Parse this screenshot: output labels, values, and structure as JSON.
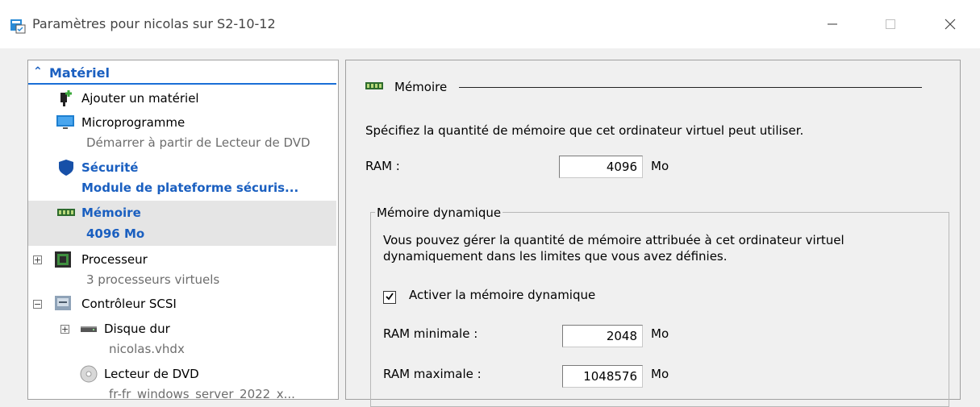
{
  "window": {
    "title": "Paramètres pour nicolas sur S2-10-12",
    "minimize_glyph": "—",
    "maximize_glyph": "☐",
    "close_glyph": "✕"
  },
  "sidebar": {
    "section_label": "Matériel",
    "items": [
      {
        "label": "Ajouter un matériel",
        "icon": "add-hardware-icon"
      },
      {
        "label": "Microprogramme",
        "sub": "Démarrer à partir de Lecteur de DVD",
        "icon": "monitor-icon"
      },
      {
        "label": "Sécurité",
        "sub": "Module de plateforme sécuris...",
        "icon": "shield-icon"
      },
      {
        "label": "Mémoire",
        "sub": "4096 Mo",
        "icon": "memory-icon",
        "selected": true
      },
      {
        "label": "Processeur",
        "sub": "3 processeurs virtuels",
        "icon": "processor-icon"
      },
      {
        "label": "Contrôleur SCSI",
        "icon": "scsi-icon"
      },
      {
        "label": "Disque dur",
        "sub": "nicolas.vhdx",
        "icon": "hard-disk-icon"
      },
      {
        "label": "Lecteur de DVD",
        "sub": "fr-fr_windows_server_2022_x...",
        "icon": "dvd-icon"
      }
    ]
  },
  "memory": {
    "group_title": "Mémoire",
    "description": "Spécifiez la quantité de mémoire que cet ordinateur virtuel peut utiliser.",
    "ram_label": "RAM :",
    "ram_value": "4096",
    "unit": "Mo",
    "dynamic": {
      "legend": "Mémoire dynamique",
      "text_line1": "Vous pouvez gérer la quantité de mémoire attribuée à cet ordinateur virtuel",
      "text_line2": "dynamiquement dans les limites que vous avez définies.",
      "enable_label": "Activer la mémoire dynamique",
      "enabled": true,
      "min_label": "RAM minimale :",
      "min_value": "2048",
      "max_label": "RAM maximale :",
      "max_value": "1048576"
    }
  },
  "colors": {
    "accent": "#1a5fc0",
    "selected_row": "#e5e5e5",
    "window_bg": "#f0f0f0"
  }
}
